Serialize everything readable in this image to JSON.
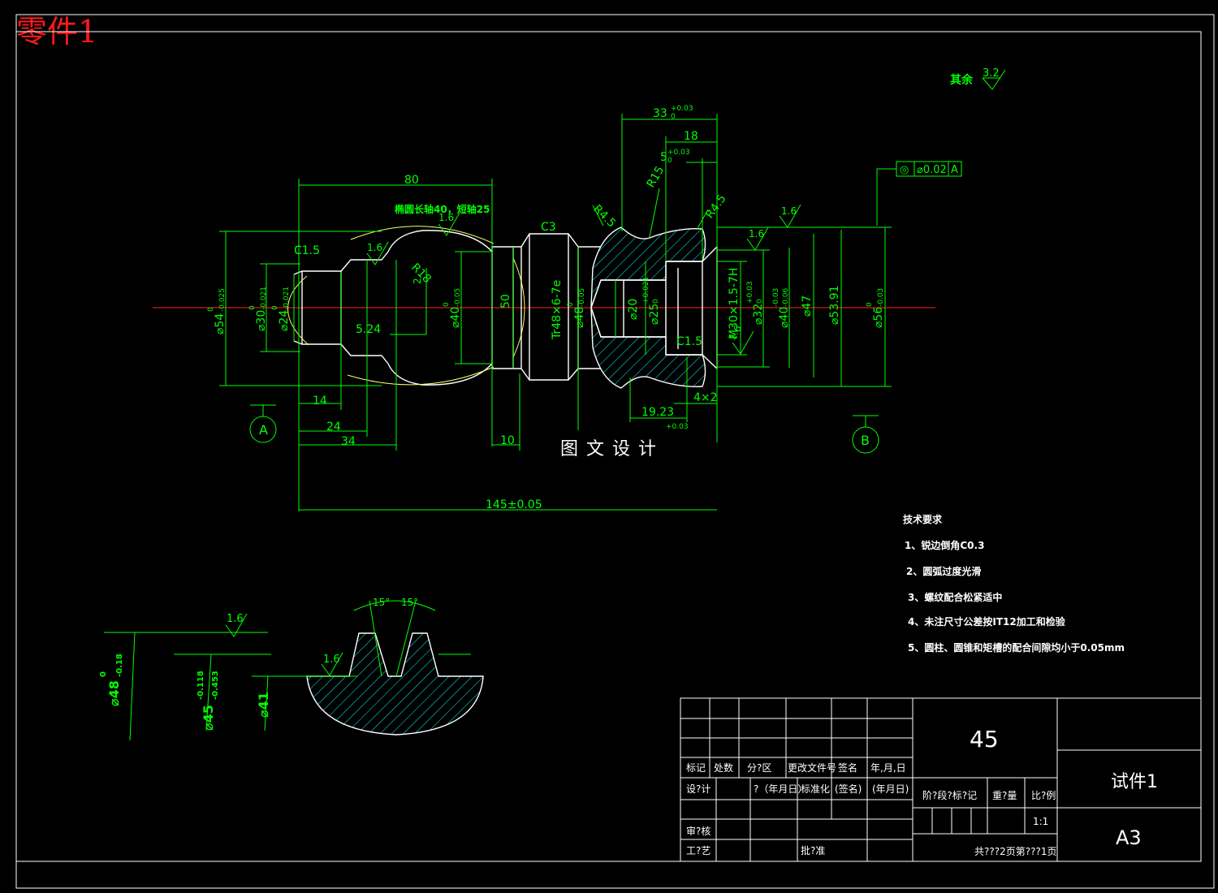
{
  "page_label": "零件1",
  "surface_finish": {
    "label": "其余",
    "value": "3.2"
  },
  "tolerance_frame": {
    "symbol": "◎",
    "value": "⌀0.02",
    "datum": "A"
  },
  "datums": {
    "a": "A",
    "b": "B"
  },
  "dimensions": {
    "d33": "33",
    "d33_tol": "+0.03",
    "d33_tol_lower": "0",
    "d18": "18",
    "d5": "5",
    "d5_tol": "+0.03",
    "d5_tol_lower": "0",
    "r15": "R15",
    "r45_left": "R4.5",
    "r45_right": "R4.5",
    "d80": "80",
    "ellipse_note": "椭圆长轴40，短轴25",
    "rough_16_top": "1.6",
    "rough_16_right": "1.6",
    "rough_16_right2": "1.6",
    "rough_16_left": "1.6",
    "rough_16_inner": "1.6",
    "c15_left": "C1.5",
    "c15_right": "C1.5",
    "c3": "C3",
    "r18": "R18",
    "d2": "2",
    "d524": "5.24",
    "d50": "50",
    "phi54": "⌀54",
    "phi54_tol": "-0.025",
    "phi54_tol_upper": "0",
    "phi30": "⌀30",
    "phi30_tol": "-0.021",
    "phi30_tol_upper": "0",
    "phi24": "⌀24",
    "phi24_tol": "-0.021",
    "phi24_tol_upper": "0",
    "phi40a": "⌀40",
    "phi40a_tol": "-0.05",
    "phi40a_tol_upper": "0",
    "tr": "Tr48×6-7e",
    "phi48": "⌀48",
    "phi48_tol": "-0.05",
    "phi48_tol_upper": "0",
    "phi20": "⌀20",
    "phi25": "⌀25",
    "phi25_tol": "+0.021",
    "phi25_tol_lower": "0",
    "m30": "M30×1.5-7H",
    "phi32": "⌀32",
    "phi32_tol": "+0.03",
    "phi32_tol_lower": "0",
    "phi40b": "⌀40",
    "phi40b_tol_upper": "-0.03",
    "phi40b_tol_lower": "-0.06",
    "phi47": "⌀47",
    "phi5391": "⌀53.91",
    "phi56": "⌀56",
    "phi56_tol": "-0.03",
    "phi56_tol_upper": "0",
    "d14": "14",
    "d24": "24",
    "d34": "34",
    "d10": "10",
    "d1923": "19.23",
    "d4x2": "4×2",
    "d003": "+0.03",
    "d145": "145±0.05"
  },
  "watermark": "图文设计",
  "detail": {
    "rough_16_a": "1.6",
    "rough_16_b": "1.6",
    "ang1": "15°",
    "ang2": "15°",
    "phi48": "⌀48",
    "phi48_tol_upper": "0",
    "phi48_tol_lower": "-0.18",
    "phi45": "⌀45",
    "phi45_tol_upper": "-0.118",
    "phi45_tol_lower": "-0.453",
    "phi41": "⌀41"
  },
  "tech_req": {
    "title": "技术要求",
    "items": [
      "1、锐边倒角C0.3",
      "2、圆弧过度光滑",
      "3、螺纹配合松紧适中",
      "4、未注尺寸公差按IT12加工和检验",
      "5、圆柱、圆锥和矩槽的配合间隙均小于0.05mm"
    ]
  },
  "title_block": {
    "mark": "标记",
    "count": "处数",
    "zone": "分?区",
    "doc": "更改文件号",
    "sign": "签名",
    "date": "年,月,日",
    "design": "设?计",
    "date_q": "?（年月日）",
    "std": "标准化",
    "sign2": "(签名)",
    "date2": "(年月日)",
    "review": "审?核",
    "craft": "工?艺",
    "approve": "批?准",
    "stage": "阶?段?标?记",
    "weight": "重?量",
    "scale_label": "比?例",
    "scale": "1:1",
    "material": "45",
    "name": "试件1",
    "size": "A3",
    "sheets": "共???2页第???1页"
  },
  "colors": {
    "outline": "#ffffff",
    "dim": "#00ff00",
    "center": "#ff2020",
    "hatch": "#00ffff",
    "label": "#ff1a1a",
    "aux": "#ffff66"
  }
}
